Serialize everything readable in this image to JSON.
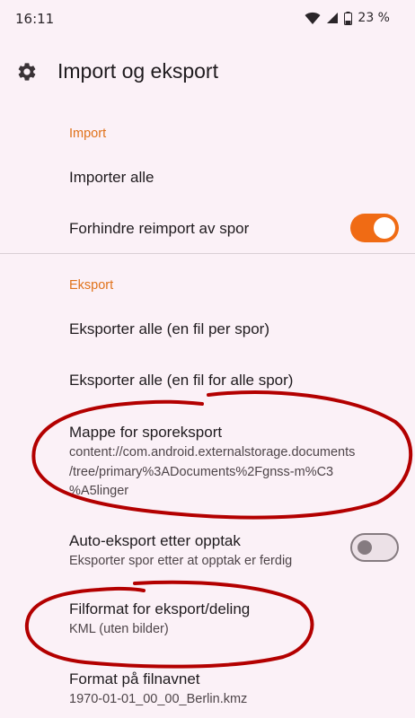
{
  "status_bar": {
    "time": "16:11",
    "battery": "23 %",
    "icons": [
      "wifi-icon",
      "cellular-signal-icon",
      "battery-icon"
    ]
  },
  "app_bar": {
    "icon": "gear-icon",
    "title": "Import og eksport"
  },
  "import_section": {
    "header": "Import",
    "import_all": "Importer alle",
    "prevent_reimport": {
      "title": "Forhindre reimport av spor",
      "enabled": true
    }
  },
  "export_section": {
    "header": "Eksport",
    "export_all_per_track": "Eksporter alle (en fil per spor)",
    "export_all_single": "Eksporter alle (en fil for alle spor)",
    "export_folder": {
      "title": "Mappe for sporeksport",
      "summary_line1": "content://com.android.externalstorage.documents",
      "summary_line2": "/tree/primary%3ADocuments%2Fgnss-m%C3",
      "summary_line3": "%A5linger"
    },
    "auto_export": {
      "title": "Auto-eksport etter opptak",
      "summary": "Eksporter spor etter at opptak er ferdig",
      "enabled": false
    },
    "file_format": {
      "title": "Filformat for eksport/deling",
      "summary": "KML (uten bilder)"
    },
    "filename_format": {
      "title": "Format på filnavnet",
      "summary": "1970-01-01_00_00_Berlin.kmz"
    }
  },
  "colors": {
    "accent": "#e0721a",
    "toggle_on": "#f06b14",
    "annotation": "#b30000",
    "background": "#fbf1f7"
  }
}
